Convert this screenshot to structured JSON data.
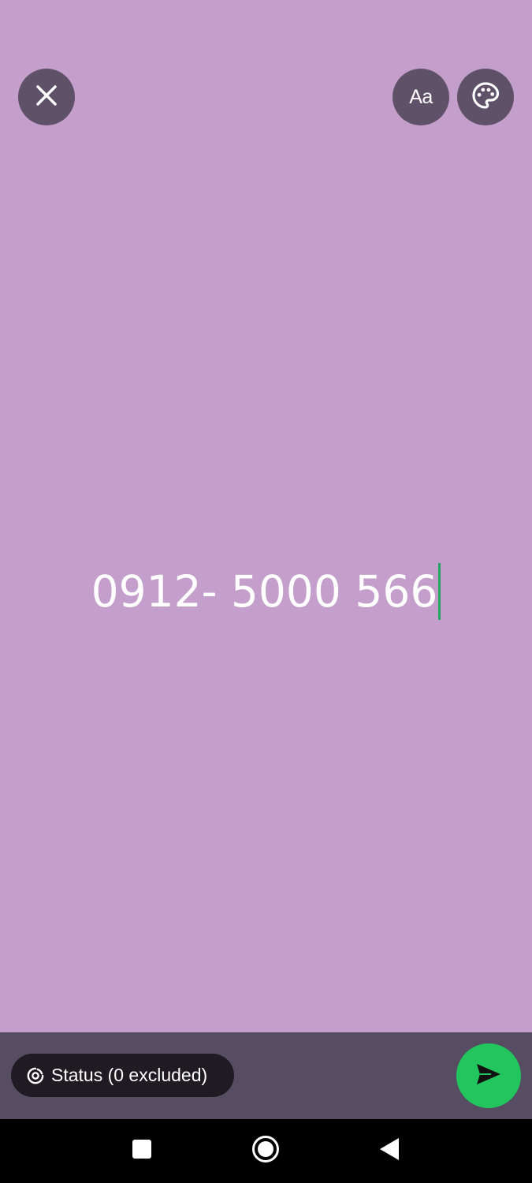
{
  "editor": {
    "typed_text": "0912- 5000 566",
    "background_color": "#C49FCB",
    "caret_color": "#25A464"
  },
  "toolbar": {
    "close_icon": "close-icon",
    "font_button_label": "Aa",
    "palette_icon": "palette-icon"
  },
  "footer": {
    "status_label": "Status (0 excluded)",
    "status_icon": "status-ring-icon",
    "send_icon": "send-icon",
    "send_color": "#22C55E"
  },
  "navigation": {
    "recents_icon": "square-recents-icon",
    "home_icon": "circle-home-icon",
    "back_icon": "triangle-back-icon"
  }
}
